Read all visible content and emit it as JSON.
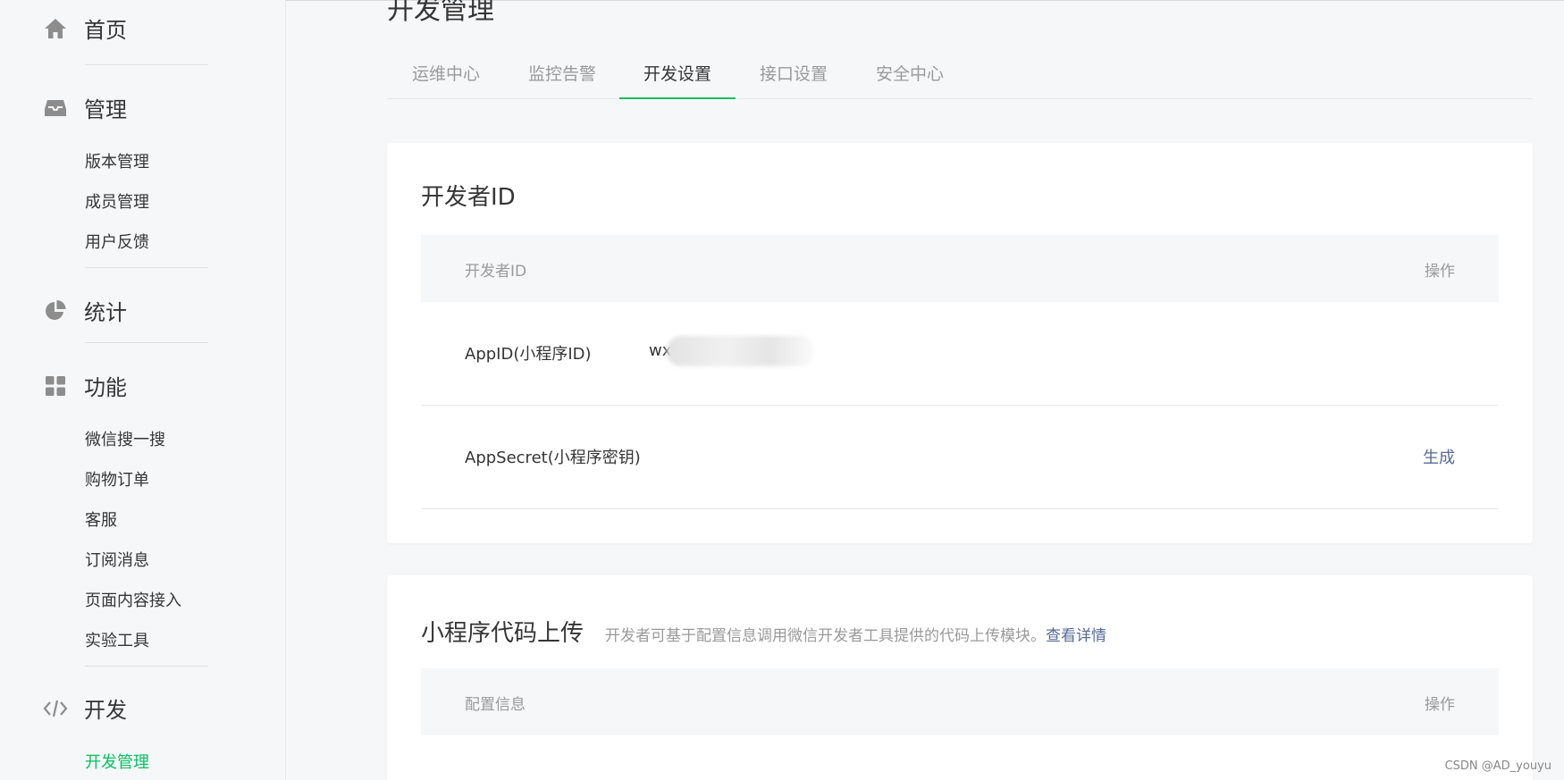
{
  "sidebar": {
    "groups": [
      {
        "icon": "home-icon",
        "label": "首页"
      },
      {
        "icon": "inbox-icon",
        "label": "管理"
      },
      {
        "icon": "pie-chart-icon",
        "label": "统计"
      },
      {
        "icon": "grid-icon",
        "label": "功能"
      },
      {
        "icon": "code-icon",
        "label": "开发"
      }
    ],
    "manage_items": [
      "版本管理",
      "成员管理",
      "用户反馈"
    ],
    "feature_items": [
      "微信搜一搜",
      "购物订单",
      "客服",
      "订阅消息",
      "页面内容接入",
      "实验工具"
    ],
    "dev_items": [
      "开发管理"
    ]
  },
  "main": {
    "title": "开发管理",
    "tabs": [
      "运维中心",
      "监控告警",
      "开发设置",
      "接口设置",
      "安全中心"
    ],
    "active_tab": "开发设置",
    "dev_id_card": {
      "title": "开发者ID",
      "header": {
        "col1": "开发者ID",
        "col2": "操作"
      },
      "rows": [
        {
          "key": "AppID(小程序ID)",
          "value": "wx",
          "op": ""
        },
        {
          "key": "AppSecret(小程序密钥)",
          "value": "",
          "op": "生成"
        }
      ]
    },
    "upload_card": {
      "title": "小程序代码上传",
      "desc": "开发者可基于配置信息调用微信开发者工具提供的代码上传模块。",
      "link": "查看详情",
      "header": {
        "col1": "配置信息",
        "col2": "操作"
      }
    }
  },
  "watermark": "CSDN @AD_youyu",
  "colors": {
    "accent": "#07c160",
    "link": "#576b95",
    "muted": "#9a9a9a"
  }
}
